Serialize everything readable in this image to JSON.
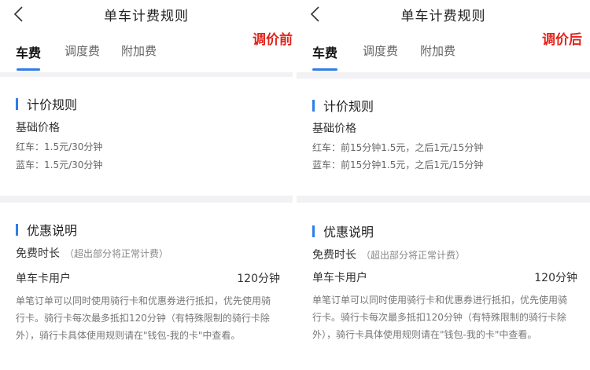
{
  "panels": {
    "left": {
      "title": "单车计费规则",
      "badge": "调价前",
      "tabs": [
        {
          "label": "车费"
        },
        {
          "label": "调度费"
        },
        {
          "label": "附加费"
        }
      ],
      "pricing": {
        "heading": "计价规则",
        "base_label": "基础价格",
        "red_bike": "红车：1.5元/30分钟",
        "blue_bike": "蓝车：1.5元/30分钟"
      },
      "discount": {
        "heading": "优惠说明",
        "free_label": "免费时长",
        "free_note": "（超出部分将正常计费）",
        "user_label": "单车卡用户",
        "user_value": "120分钟",
        "desc_lines": [
          "单笔订单可以同时使用骑行卡和优惠券进行抵扣，优先使用骑",
          "行卡。骑行卡每次最多抵扣120分钟（有特殊限制的骑行卡除",
          "外），骑行卡具体使用规则请在\"钱包-我的卡\"中查看。"
        ]
      }
    },
    "right": {
      "title": "单车计费规则",
      "badge": "调价后",
      "tabs": [
        {
          "label": "车费"
        },
        {
          "label": "调度费"
        },
        {
          "label": "附加费"
        }
      ],
      "pricing": {
        "heading": "计价规则",
        "base_label": "基础价格",
        "red_bike": "红车：前15分钟1.5元，之后1元/15分钟",
        "blue_bike": "蓝车：前15分钟1.5元，之后1元/15分钟"
      },
      "discount": {
        "heading": "优惠说明",
        "free_label": "免费时长",
        "free_note": "（超出部分将正常计费）",
        "user_label": "单车卡用户",
        "user_value": "120分钟",
        "desc_lines": [
          "单笔订单可以同时使用骑行卡和优惠券进行抵扣，优先使用骑",
          "行卡。骑行卡每次最多抵扣120分钟（有特殊限制的骑行卡除",
          "外），骑行卡具体使用规则请在\"钱包-我的卡\"中查看。"
        ]
      }
    }
  },
  "colors": {
    "accent": "#2f7ee5",
    "badge_red": "#e0251c",
    "background_gray": "#f2f2f4"
  },
  "icons": {
    "back": "chevron-left-icon"
  }
}
